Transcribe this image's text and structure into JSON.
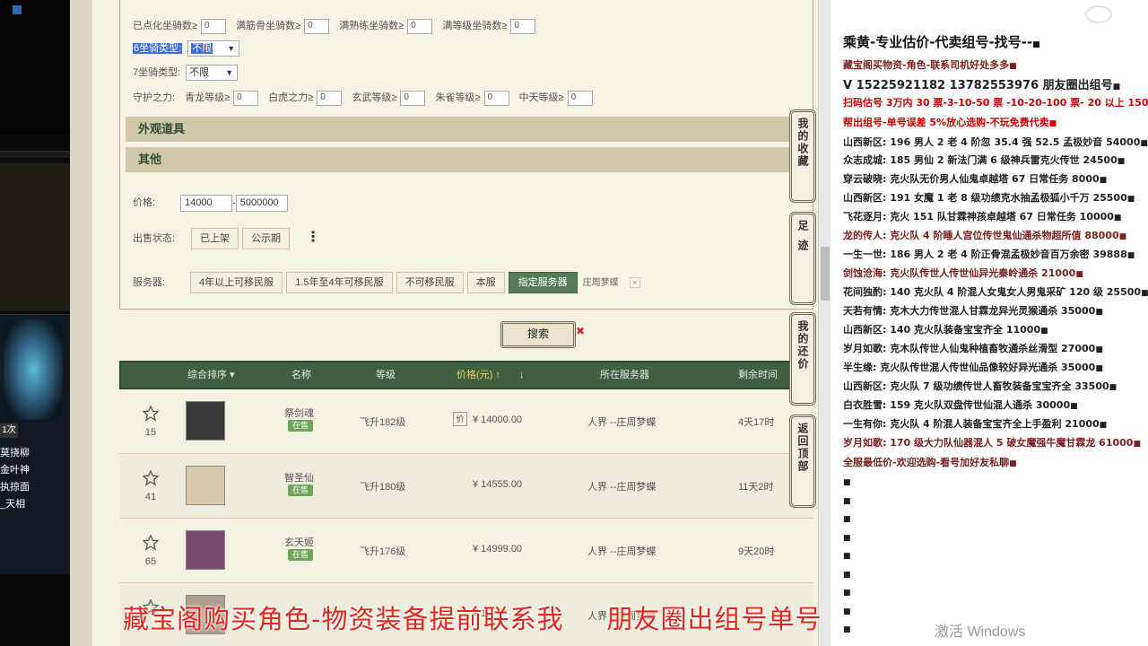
{
  "left_strip": {
    "badge": "1次",
    "texts": [
      "莫挠柳",
      "金叶神",
      "执掠面",
      "_天相"
    ]
  },
  "filters": {
    "row1": {
      "labels": [
        "已点化坐骑数≥",
        "满筋骨坐骑数≥",
        "满熟练坐骑数≥",
        "满等级坐骑数≥"
      ],
      "values": [
        "0",
        "0",
        "0",
        "0"
      ]
    },
    "mount6_label": "6坐骑类型:",
    "mount6_value": "不限",
    "mount7_label": "7坐骑类型:",
    "mount7_value": "不限",
    "guard_label": "守护之力:",
    "guard": [
      {
        "label": "青龙等级≥",
        "value": "0"
      },
      {
        "label": "白虎之力≥",
        "value": "0"
      },
      {
        "label": "玄武等级≥",
        "value": "0"
      },
      {
        "label": "朱雀等级≥",
        "value": "0"
      },
      {
        "label": "中天等级≥",
        "value": "0"
      }
    ],
    "section_appearance": "外观道具",
    "section_other": "其他",
    "price_label": "价格:",
    "price_min": "14000",
    "price_sep": "-",
    "price_max": "5000000",
    "status_label": "出售状态:",
    "status_buttons": [
      "已上架",
      "公示期"
    ],
    "more": "⋮",
    "server_label": "服务器:",
    "server_buttons": [
      "4年以上可移民服",
      "1.5年至4年可移民服",
      "不可移民服",
      "本服"
    ],
    "server_selected": "指定服务器",
    "server_chip": "庄周梦蝶",
    "server_chip_close": "×"
  },
  "search": {
    "label": "搜索",
    "clear": "✖"
  },
  "table": {
    "headers": {
      "sort": "综合排序 ▾",
      "name": "名称",
      "level": "等级",
      "price": "价格(元) ↑",
      "price_down": "↓",
      "server": "所在服务器",
      "time": "剩余时间"
    },
    "rows": [
      {
        "likes": "15",
        "name": "祭剑魂",
        "tag": "在售",
        "level": "飞升182级",
        "price": "¥ 14000.00",
        "server": "人界 --庄周梦蝶",
        "time": "4天17时",
        "avatar": "#3a3a3a",
        "price_icon": "价"
      },
      {
        "likes": "41",
        "name": "智圣仙",
        "tag": "在售",
        "level": "飞升180级",
        "price": "¥ 14555.00",
        "server": "人界 --庄周梦蝶",
        "time": "11天2时",
        "avatar": "#d9c8b0",
        "price_icon": ""
      },
      {
        "likes": "65",
        "name": "玄天姬",
        "tag": "在售",
        "level": "飞升176级",
        "price": "¥ 14999.00",
        "server": "人界 --庄周梦蝶",
        "time": "9天20时",
        "avatar": "#7a4a6a",
        "price_icon": ""
      },
      {
        "likes": "",
        "name": "",
        "tag": "",
        "level": "",
        "price": "¥ 1...",
        "server": "人界 --庄周梦蝶",
        "time": "",
        "avatar": "#b0a090",
        "price_icon": ""
      }
    ]
  },
  "side_tabs": [
    {
      "label": "我的收藏"
    },
    {
      "label": "足迹"
    },
    {
      "label": "我的还价"
    },
    {
      "label": "返回顶部"
    }
  ],
  "notes": {
    "title": "乘黄-专业估价-代卖组号-找号--",
    "lines": [
      {
        "text": "藏宝阁买物资-角色-联系司机好处多多",
        "style": "maroon"
      },
      {
        "text": "V 15225921182   13782553976 朋友圈出组号",
        "style": "big"
      },
      {
        "text": "扫码估号 3万内 30 票-3-10-50 票  -10-20-100 票- 20 以上 150",
        "style": "red"
      },
      {
        "text": "帮出组号-单号误差 5%放心选购-不玩免费代卖",
        "style": "red"
      },
      {
        "text": "山西新区: 196 男人 2 老 4 阶忽 35.4 强 52.5 孟极妙音 54000",
        "style": ""
      },
      {
        "text": "众志成城: 185 男仙 2 新法门满 6 级神兵雷克火传世 24500",
        "style": ""
      },
      {
        "text": "穿云破晓: 克火队无价男人仙鬼卓越塔 67 日常任务 8000",
        "style": ""
      },
      {
        "text": "山西新区: 191 女魔 1 老 8 级功绩克水抽孟极狐小千万 25500",
        "style": ""
      },
      {
        "text": "飞花逐月: 克火 151 队甘霖神孩卓越塔 67 日常任务 10000",
        "style": ""
      },
      {
        "text": "龙的传人: 克火队 4 阶睡人宫位传世鬼仙通杀物超所值 88000",
        "style": "maroon"
      },
      {
        "text": "一生一世: 186 男人 2 老 4 阶正骨混孟极妙音百万余密 39888",
        "style": ""
      },
      {
        "text": "剑蚀沧海: 克火队传世人传世仙异光秦岭通杀 21000",
        "style": "maroon"
      },
      {
        "text": "花间独酌: 140 克火队 4 阶混人女鬼女人男鬼采矿 120 级 25500",
        "style": ""
      },
      {
        "text": "天若有情: 克木大力传世混人甘霖龙异光灵猴通杀 35000",
        "style": ""
      },
      {
        "text": "山西新区: 140 克火队装备宝宝齐全 11000",
        "style": ""
      },
      {
        "text": "岁月如歌: 克木队传世人仙鬼种植畜牧通杀丝滑型 27000",
        "style": ""
      },
      {
        "text": "半生缘: 克火队传世混人传世仙品像较好异光通杀 35000",
        "style": ""
      },
      {
        "text": "山西新区: 克火队 7 级功绩传世人畜牧装备宝宝齐全 33500",
        "style": ""
      },
      {
        "text": "白衣胜雪: 159 克火队双盘传世仙混人通杀 30000",
        "style": ""
      },
      {
        "text": "一生有你: 克火队 4 阶混人装备宝宝齐全上手盈利 21000",
        "style": ""
      },
      {
        "text": "岁月如歌: 170 级大力队仙器混人 5 破女魔强牛魔甘霖龙 61000",
        "style": "maroon"
      },
      {
        "text": "全服最低价-欢迎选购-看号加好友私聊",
        "style": "maroon"
      }
    ],
    "bullet": "■"
  },
  "overlay": {
    "left": "藏宝阁购买角色-物资装备提前联系我",
    "right": "朋友圈出组号单号"
  },
  "activate": "激活 Windows"
}
